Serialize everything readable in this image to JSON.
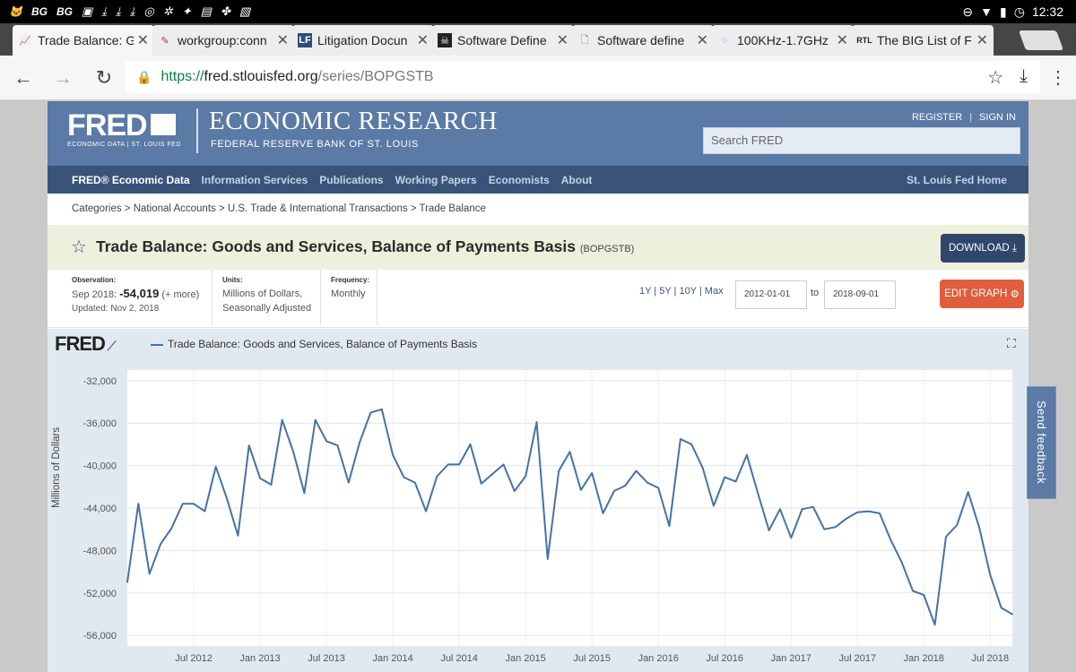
{
  "status_bar": {
    "left_icons": [
      "cat-icon",
      "bg-label",
      "bg-label",
      "image-icon",
      "download-icon",
      "download-icon",
      "download-icon",
      "instagram-icon",
      "app-icon",
      "twitter-icon",
      "app-icon",
      "app-icon",
      "app-icon"
    ],
    "bg1": "BG",
    "bg2": "BG",
    "time": "12:32"
  },
  "tabs": [
    {
      "title": "Trade Balance: G",
      "active": true
    },
    {
      "title": "workgroup:conn",
      "active": false
    },
    {
      "title": "Litigation Docun",
      "active": false
    },
    {
      "title": "Software Define",
      "active": false
    },
    {
      "title": "Software define",
      "active": false
    },
    {
      "title": "100KHz-1.7GHz",
      "active": false
    },
    {
      "title": "The BIG List of F",
      "active": false
    }
  ],
  "url": {
    "scheme": "https://",
    "host": "fred.stlouisfed.org",
    "path": "/series/BOPGSTB"
  },
  "header": {
    "logo": "FRED",
    "logo_sub": "ECONOMIC DATA  |  ST. LOUIS FED",
    "title": "ECONOMIC RESEARCH",
    "subtitle": "FEDERAL RESERVE BANK OF ST. LOUIS",
    "register": "REGISTER",
    "signin": "SIGN IN",
    "search_placeholder": "Search FRED"
  },
  "nav": {
    "items": [
      "FRED® Economic Data",
      "Information Services",
      "Publications",
      "Working Papers",
      "Economists",
      "About"
    ],
    "right": "St. Louis Fed Home"
  },
  "breadcrumb": "Categories > National Accounts > U.S. Trade & International Transactions > Trade Balance",
  "series": {
    "title": "Trade Balance: Goods and Services, Balance of Payments Basis",
    "id": "(BOPGSTB)",
    "download": "DOWNLOAD"
  },
  "meta": {
    "obs_label": "Observation:",
    "obs_date": "Sep 2018:",
    "obs_value": "-54,019",
    "obs_more": "(+ more)",
    "updated": "Updated: Nov 2, 2018",
    "units_label": "Units:",
    "units1": "Millions of Dollars,",
    "units2": "Seasonally Adjusted",
    "freq_label": "Frequency:",
    "freq": "Monthly",
    "ranges": "1Y | 5Y | 10Y | Max",
    "date_from": "2012-01-01",
    "to": "to",
    "date_to": "2018-09-01",
    "edit": "EDIT GRAPH"
  },
  "graph": {
    "logo": "FRED",
    "legend": "Trade Balance: Goods and Services, Balance of Payments Basis",
    "ylabel": "Millions of Dollars"
  },
  "feedback": "Send feedback",
  "chart_data": {
    "type": "line",
    "title": "",
    "xlabel": "",
    "ylabel": "Millions of Dollars",
    "ylim": [
      -57000,
      -31000
    ],
    "yticks": [
      -32000,
      -36000,
      -40000,
      -44000,
      -48000,
      -52000,
      -56000
    ],
    "ytick_labels": [
      "-32,000",
      "-36,000",
      "-40,000",
      "-44,000",
      "-48,000",
      "-52,000",
      "-56,000"
    ],
    "xticks": [
      "2012-07",
      "2013-01",
      "2013-07",
      "2014-01",
      "2014-07",
      "2015-01",
      "2015-07",
      "2016-01",
      "2016-07",
      "2017-01",
      "2017-07",
      "2018-01",
      "2018-07"
    ],
    "xtick_labels": [
      "Jul 2012",
      "Jan 2013",
      "Jul 2013",
      "Jan 2014",
      "Jul 2014",
      "Jan 2015",
      "Jul 2015",
      "Jan 2016",
      "Jul 2016",
      "Jan 2017",
      "Jul 2017",
      "Jan 2018",
      "Jul 2018"
    ],
    "x_start": "2012-01",
    "grid": true,
    "color": "#4572a7",
    "series": [
      {
        "values": [
          -51000,
          -43600,
          -50200,
          -47400,
          -45900,
          -43600,
          -43600,
          -44300,
          -40100,
          -43100,
          -46600,
          -38100,
          -41200,
          -41800,
          -35700,
          -38700,
          -42600,
          -35700,
          -37700,
          -38100,
          -41600,
          -37800,
          -35000,
          -34700,
          -39000,
          -41100,
          -41600,
          -44300,
          -41000,
          -39900,
          -39900,
          -38000,
          -41700,
          -40800,
          -39900,
          -42400,
          -41000,
          -35900,
          -48800,
          -40500,
          -38700,
          -42300,
          -40700,
          -44500,
          -42400,
          -41900,
          -40500,
          -41600,
          -42100,
          -45700,
          -37500,
          -38000,
          -40200,
          -43800,
          -41100,
          -41500,
          -39000,
          -42600,
          -46100,
          -44100,
          -46800,
          -44100,
          -43900,
          -46000,
          -45800,
          -45000,
          -44400,
          -44300,
          -44500,
          -47000,
          -49100,
          -51800,
          -52200,
          -55000,
          -46700,
          -45600,
          -42500,
          -45800,
          -50300,
          -53400,
          -54000
        ]
      }
    ]
  }
}
